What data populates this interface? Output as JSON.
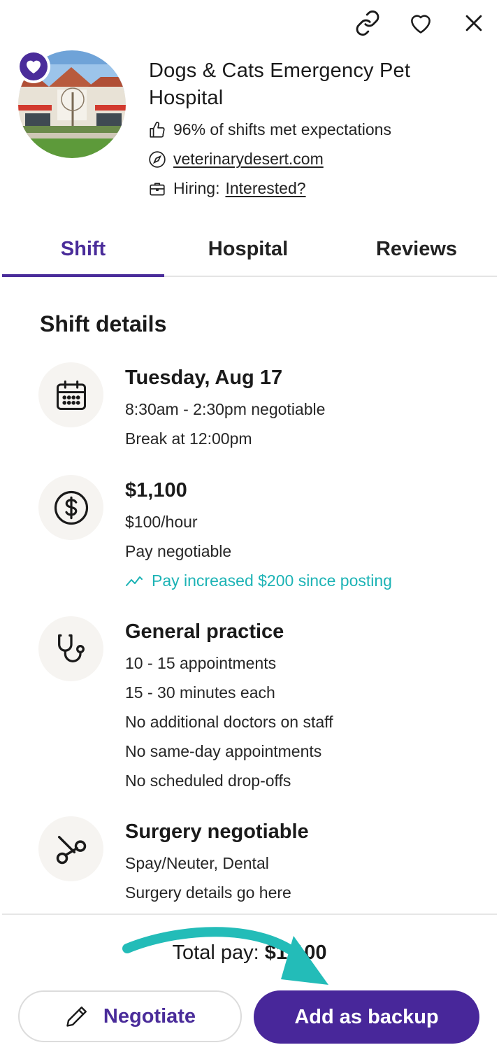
{
  "header": {
    "icons": [
      "link-icon",
      "heart-outline-icon",
      "close-icon"
    ]
  },
  "hospital": {
    "name": "Dogs & Cats Emergency Pet Hospital",
    "shifts_met": "96% of shifts met expectations",
    "website": "veterinarydesert.com",
    "hiring_label": "Hiring:",
    "hiring_link": "Interested?"
  },
  "tabs": [
    {
      "label": "Shift",
      "active": true
    },
    {
      "label": "Hospital",
      "active": false
    },
    {
      "label": "Reviews",
      "active": false
    }
  ],
  "shift_details": {
    "title": "Shift details",
    "date": {
      "icon": "calendar-icon",
      "title": "Tuesday, Aug 17",
      "lines": [
        "8:30am - 2:30pm negotiable",
        "Break at 12:00pm"
      ]
    },
    "pay": {
      "icon": "dollar-icon",
      "title": "$1,100",
      "lines": [
        "$100/hour",
        "Pay negotiable"
      ],
      "increase": "Pay increased $200 since posting"
    },
    "practice": {
      "icon": "stethoscope-icon",
      "title": "General practice",
      "lines": [
        "10 - 15 appointments",
        "15 - 30 minutes each",
        "No additional doctors on staff",
        "No same-day appointments",
        "No scheduled drop-offs"
      ]
    },
    "surgery": {
      "icon": "scissors-icon",
      "title": "Surgery negotiable",
      "lines": [
        "Spay/Neuter, Dental",
        "Surgery details go here"
      ]
    }
  },
  "footer": {
    "total_label": "Total pay:",
    "total_value": "$1,100",
    "negotiate_label": "Negotiate",
    "backup_label": "Add as backup"
  },
  "colors": {
    "brand": "#4a2c9a",
    "accent_teal": "#1cb3b5"
  }
}
